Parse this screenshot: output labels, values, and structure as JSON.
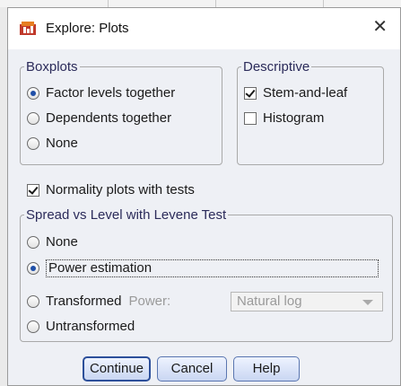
{
  "dialog": {
    "title": "Explore: Plots",
    "close_glyph": "✕"
  },
  "boxplots": {
    "legend": "Boxplots",
    "options": [
      {
        "label": "Factor levels together",
        "selected": true
      },
      {
        "label": "Dependents together",
        "selected": false
      },
      {
        "label": "None",
        "selected": false
      }
    ]
  },
  "descriptive": {
    "legend": "Descriptive",
    "options": [
      {
        "label": "Stem-and-leaf",
        "checked": true
      },
      {
        "label": "Histogram",
        "checked": false
      }
    ]
  },
  "normality": {
    "label": "Normality plots with tests",
    "checked": true
  },
  "spread": {
    "legend": "Spread vs Level with Levene Test",
    "options": [
      {
        "label": "None",
        "selected": false
      },
      {
        "label": "Power estimation",
        "selected": true
      },
      {
        "label": "Transformed",
        "selected": false
      },
      {
        "label": "Untransformed",
        "selected": false
      }
    ],
    "power_label": "Power:",
    "power_value": "Natural log"
  },
  "buttons": {
    "continue": "Continue",
    "cancel": "Cancel",
    "help": "Help"
  },
  "colors": {
    "accent": "#2c4f9a",
    "panel": "#eef0f5"
  }
}
